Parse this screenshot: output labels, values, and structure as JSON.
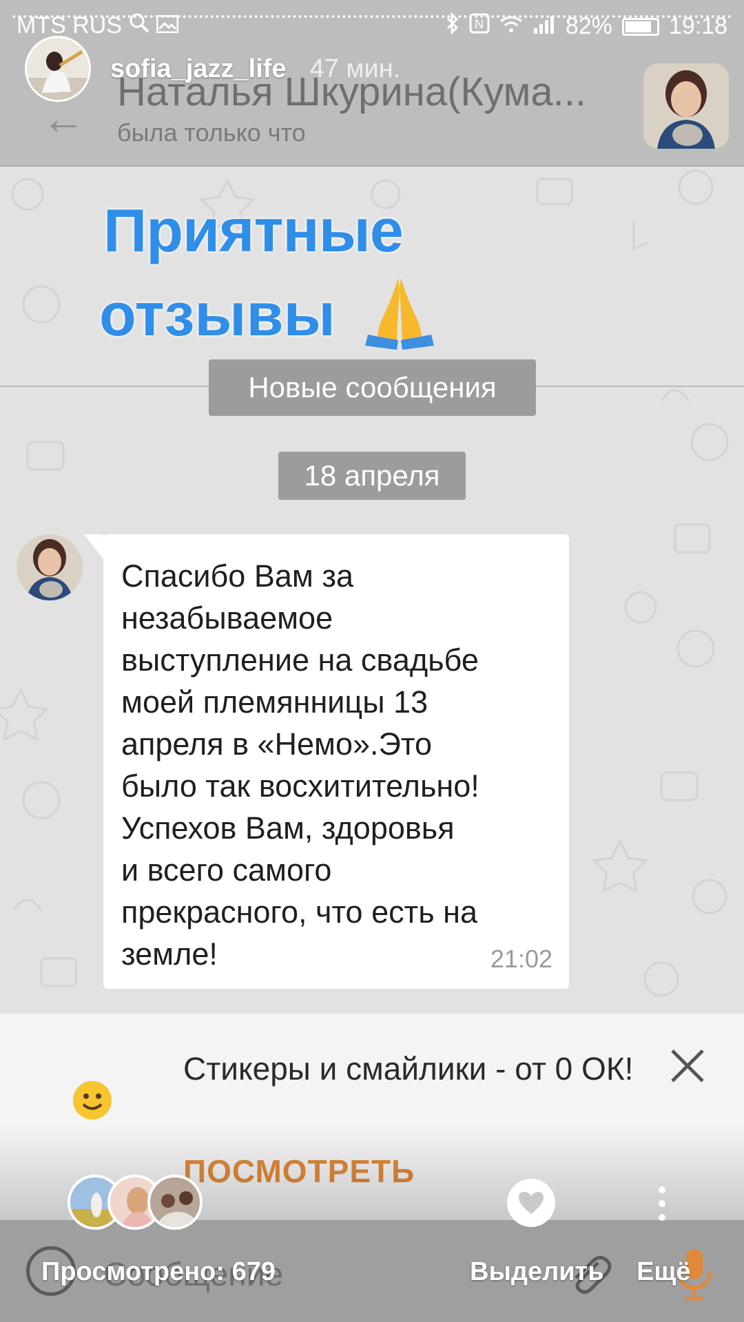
{
  "status_bar": {
    "carrier": "MTS RUS",
    "battery": "82%",
    "time": "19:18"
  },
  "story": {
    "username": "sofia_jazz_life",
    "time_ago": "47 мин.",
    "viewed": "Просмотрено: 679",
    "select_label": "Выделить",
    "more_label": "Ещё"
  },
  "header": {
    "contact_name": "Наталья Шкурина(Кума...",
    "contact_status": "была только что"
  },
  "overlay": {
    "title_line1": "Приятные",
    "title_line2": "отзывы"
  },
  "chat": {
    "new_messages": "Новые сообщения",
    "date": "18 апреля",
    "message": {
      "text": "Спасибо Вам за\nнезабываемое\nвыступление на свадьбе\nмоей племянницы 13\nапреля в «Немо».Это\nбыло так восхитительно!\nУспехов Вам, здоровья\nи всего самого\nпрекрасного, что есть на\nземле!",
      "time": "21:02"
    }
  },
  "promo": {
    "text": "Стикеры и смайлики - от 0 ОК!",
    "action": "ПОСМОТРЕТЬ"
  },
  "input": {
    "placeholder": "Сообщение"
  },
  "colors": {
    "accent_blue": "#2f8ee8",
    "promo_orange": "#e0893a"
  }
}
